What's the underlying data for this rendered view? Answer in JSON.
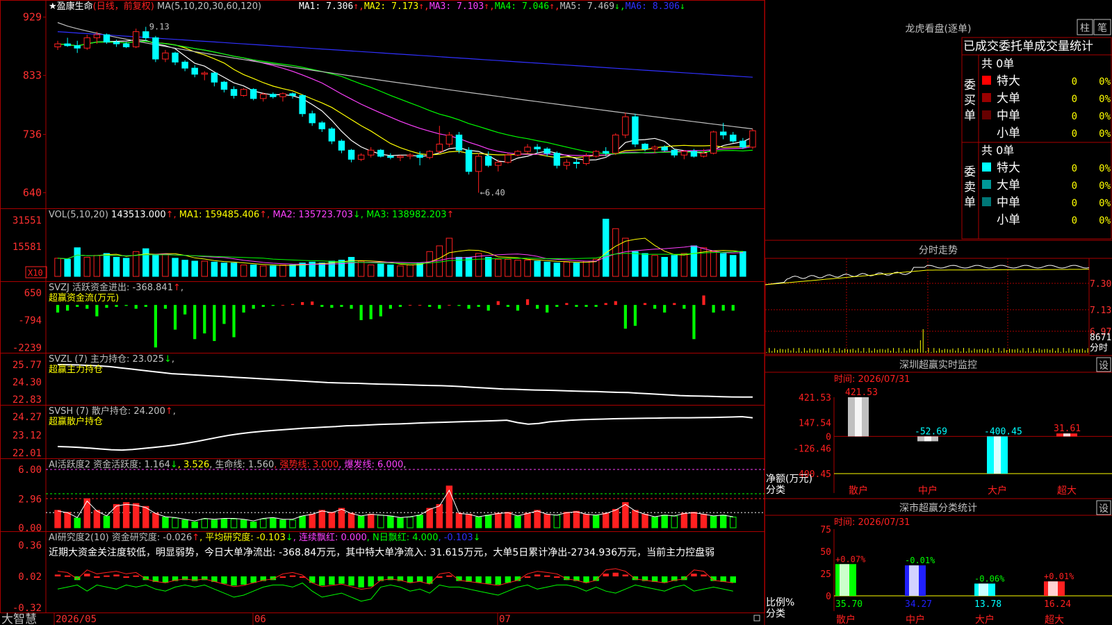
{
  "colors": {
    "up": "#ff2020",
    "down": "#00ffff",
    "bg": "#000000",
    "grid": "#aa0000",
    "axisText": "#ff3030",
    "white": "#ffffff",
    "yellow": "#ffff00",
    "magenta": "#ff40ff",
    "green": "#00ff00",
    "blue": "#3030ff",
    "gray": "#c0c0c0",
    "cyanbar": "#00ffff"
  },
  "main": {
    "title": "★盈康生命",
    "period": "(日线，前复权)",
    "ma_prefix": "MA(5,10,20,30,60,120)",
    "ma_legend": [
      {
        "label": "MA1:",
        "value": "7.306",
        "arrow": "↑",
        "color": "#ffffff"
      },
      {
        "label": "MA2:",
        "value": "7.173",
        "arrow": "↑",
        "color": "#ffff00"
      },
      {
        "label": "MA3:",
        "value": "7.103",
        "arrow": "↑",
        "color": "#ff40ff"
      },
      {
        "label": "MA4:",
        "value": "7.046",
        "arrow": "↑",
        "color": "#00ff00"
      },
      {
        "label": "MA5:",
        "value": "7.469",
        "arrow": "↓",
        "color": "#c0c0c0"
      },
      {
        "label": "MA6:",
        "value": "8.306",
        "arrow": "↓",
        "color": "#3030ff"
      }
    ],
    "yticks": [
      "929",
      "833",
      "736",
      "640"
    ],
    "high_label": "9.13",
    "low_label": "←6.40"
  },
  "vol": {
    "legend_prefix": "VOL(5,10,20)",
    "value": "143513.000",
    "ma1": "MA1: 159485.406",
    "ma2": "MA2: 135723.703",
    "ma3": "MA3: 138982.203",
    "ma1_arrow": "↑",
    "ma2_arrow": "↓",
    "ma3_arrow": "↑",
    "yticks": [
      "31551",
      "15581"
    ],
    "unit": "X10"
  },
  "svzj": {
    "label": "SVZJ  活跃资金进出: -368.841",
    "arrow": "↑",
    "arrow2": ",",
    "sub": "超赢资金流(万元)",
    "yticks": [
      "650",
      "-794",
      "-2239"
    ]
  },
  "svzl": {
    "label": "SVZL (7) 主力持仓: 23.025",
    "arrow": "↓",
    "arrow2": ",",
    "sub": "超赢主力持仓",
    "yticks": [
      "25.77",
      "24.30",
      "22.83"
    ]
  },
  "svsh": {
    "label": "SVSH (7) 散户持仓: 24.200",
    "arrow": "↑",
    "arrow2": ",",
    "sub": "超赢散户持仓",
    "yticks": [
      "24.27",
      "23.12",
      "22.01"
    ]
  },
  "ai1": {
    "label": "AI活跃度2 资金活跃度: 1.164",
    "a1": "↓",
    "v2": ", 3.526",
    "v3": ", 生命线: 1.560",
    "v4": ", 强势线: 3.000",
    "v5": ", 爆发线: 6.000",
    "v6": ",",
    "yticks": [
      "6.00",
      "2.96",
      "0.00"
    ]
  },
  "ai2": {
    "label": "AI研究度2(10) 资金研究度: -0.026",
    "a1": "↑",
    "v2": ", 平均研究度: -0.103",
    "a2": "↓",
    "v3": ", 连续飘红: 0.000",
    "v4": ", N日飘红: 4.000",
    "v5": ", -0.103",
    "a5": "↓",
    "note": "近期大资金关注度较低，明显弱势，今日大单净流出: -368.84万元，其中特大单净流入: 31.615万元，大单5日累计净出-2734.936万元，当前主力控盘弱",
    "yticks": [
      "0.36",
      "0.02",
      "-0.32"
    ]
  },
  "footer": {
    "brand": "大智慧",
    "dates": [
      "2026/05",
      "06",
      "07"
    ]
  },
  "lhb": {
    "title": "龙虎看盘(逐单)",
    "btn1": "柱",
    "btn2": "笔",
    "subtitle": "已成交委托单成交量统计",
    "buy_side": "委买单",
    "sell_side": "委卖单",
    "buy_total": "共 0单",
    "sell_total": "共 0单",
    "buy_rows": [
      {
        "name": "特大",
        "val": "0",
        "pct": "0%",
        "color": "#ff0000"
      },
      {
        "name": "大单",
        "val": "0",
        "pct": "0%",
        "color": "#990000"
      },
      {
        "name": "中单",
        "val": "0",
        "pct": "0%",
        "color": "#660000"
      },
      {
        "name": "小单",
        "val": "0",
        "pct": "0%",
        "color": "#000000"
      }
    ],
    "sell_rows": [
      {
        "name": "特大",
        "val": "0",
        "pct": "0%",
        "color": "#00ffff"
      },
      {
        "name": "大单",
        "val": "0",
        "pct": "0%",
        "color": "#009999"
      },
      {
        "name": "中单",
        "val": "0",
        "pct": "0%",
        "color": "#007777"
      },
      {
        "name": "小单",
        "val": "0",
        "pct": "0%",
        "color": "#000000"
      }
    ]
  },
  "intraday": {
    "title": "分时走势",
    "yticks": [
      "7.30",
      "7.13",
      "6.97"
    ],
    "vol_tick": "8671",
    "vol_label": "分时"
  },
  "monitor": {
    "title": "深圳超赢实时监控",
    "btn": "设",
    "time": "时间: 2026/07/31",
    "yticks": [
      "421.53",
      "147.54",
      "0",
      "-126.46",
      "-400.45"
    ],
    "ylabel": "净额(万元)",
    "xlabel": "分类",
    "cats": [
      {
        "name": "散户",
        "value": 421.53,
        "label": "421.53"
      },
      {
        "name": "中户",
        "value": -52.69,
        "label": "-52.69"
      },
      {
        "name": "大户",
        "value": -400.45,
        "label": "-400.45"
      },
      {
        "name": "超大",
        "value": 31.61,
        "label": "31.61"
      }
    ]
  },
  "classstat": {
    "title": "深市超赢分类统计",
    "btn": "设",
    "time": "时间: 2026/07/31",
    "yticks": [
      "75",
      "50",
      "25",
      "0"
    ],
    "ylabel": "比例%",
    "xlabel": "分类",
    "cats": [
      {
        "name": "散户",
        "value": 35.7,
        "label": "35.70",
        "delta": "+0.07%",
        "color": "#00ff00"
      },
      {
        "name": "中户",
        "value": 34.27,
        "label": "34.27",
        "delta": "-0.01%",
        "color": "#2020ff"
      },
      {
        "name": "大户",
        "value": 13.78,
        "label": "13.78",
        "delta": "-0.06%",
        "color": "#00ffff"
      },
      {
        "name": "超大",
        "value": 16.24,
        "label": "16.24",
        "delta": "+0.01%",
        "color": "#ff2020"
      }
    ]
  },
  "chart_data": [
    {
      "type": "candlestick",
      "title": "盈康生命 (日线，前复权)",
      "ylim": [
        6.2,
        9.4
      ],
      "ohlc": [
        [
          8.8,
          8.9,
          8.75,
          8.85
        ],
        [
          8.85,
          8.95,
          8.8,
          8.82
        ],
        [
          8.82,
          8.9,
          8.7,
          8.78
        ],
        [
          8.78,
          9.0,
          8.75,
          8.95
        ],
        [
          8.95,
          9.05,
          8.85,
          9.0
        ],
        [
          9.0,
          9.02,
          8.85,
          8.88
        ],
        [
          8.88,
          8.92,
          8.8,
          8.85
        ],
        [
          8.85,
          8.88,
          8.78,
          8.8
        ],
        [
          8.8,
          9.1,
          8.78,
          9.05
        ],
        [
          9.05,
          9.13,
          8.9,
          8.95
        ],
        [
          8.95,
          8.98,
          8.55,
          8.6
        ],
        [
          8.6,
          8.75,
          8.55,
          8.7
        ],
        [
          8.7,
          8.72,
          8.5,
          8.55
        ],
        [
          8.55,
          8.58,
          8.4,
          8.45
        ],
        [
          8.45,
          8.5,
          8.3,
          8.35
        ],
        [
          8.35,
          8.4,
          8.25,
          8.37
        ],
        [
          8.37,
          8.38,
          8.15,
          8.22
        ],
        [
          8.22,
          8.24,
          8.05,
          8.1
        ],
        [
          8.1,
          8.15,
          7.95,
          8.0
        ],
        [
          8.0,
          8.12,
          7.98,
          8.1
        ],
        [
          8.1,
          8.12,
          7.92,
          7.95
        ],
        [
          7.95,
          8.05,
          7.9,
          8.02
        ],
        [
          8.02,
          8.05,
          7.95,
          7.98
        ],
        [
          7.98,
          8.05,
          7.9,
          8.03
        ],
        [
          8.03,
          8.05,
          7.95,
          8.0
        ],
        [
          8.0,
          8.02,
          7.65,
          7.7
        ],
        [
          7.7,
          7.75,
          7.5,
          7.55
        ],
        [
          7.55,
          7.58,
          7.4,
          7.45
        ],
        [
          7.45,
          7.48,
          7.2,
          7.25
        ],
        [
          7.25,
          7.28,
          7.05,
          7.1
        ],
        [
          7.1,
          7.12,
          6.9,
          6.95
        ],
        [
          6.95,
          7.05,
          6.92,
          7.02
        ],
        [
          7.02,
          7.15,
          6.98,
          7.1
        ],
        [
          7.1,
          7.12,
          6.98,
          7.0
        ],
        [
          7.0,
          7.05,
          6.95,
          6.98
        ],
        [
          6.98,
          7.02,
          6.92,
          7.0
        ],
        [
          7.0,
          7.05,
          6.95,
          7.02
        ],
        [
          7.02,
          7.08,
          6.85,
          6.98
        ],
        [
          6.98,
          7.1,
          6.95,
          7.08
        ],
        [
          7.08,
          7.5,
          7.05,
          7.2
        ],
        [
          7.2,
          7.4,
          7.15,
          7.35
        ],
        [
          7.35,
          7.4,
          7.05,
          7.1
        ],
        [
          7.1,
          7.15,
          6.7,
          6.75
        ],
        [
          6.75,
          7.05,
          6.4,
          7.0
        ],
        [
          7.0,
          7.08,
          6.82,
          6.85
        ],
        [
          6.85,
          6.95,
          6.75,
          6.9
        ],
        [
          6.9,
          7.05,
          6.88,
          7.02
        ],
        [
          7.02,
          7.1,
          7.0,
          7.08
        ],
        [
          7.08,
          7.2,
          7.05,
          7.15
        ],
        [
          7.15,
          7.2,
          7.05,
          7.12
        ],
        [
          7.12,
          7.15,
          7.0,
          7.05
        ],
        [
          7.05,
          7.08,
          6.8,
          6.85
        ],
        [
          6.85,
          6.95,
          6.78,
          6.9
        ],
        [
          6.9,
          6.95,
          6.8,
          6.88
        ],
        [
          6.88,
          7.05,
          6.85,
          7.0
        ],
        [
          7.0,
          7.1,
          6.98,
          7.08
        ],
        [
          7.08,
          7.15,
          7.0,
          7.05
        ],
        [
          7.05,
          7.38,
          7.02,
          7.35
        ],
        [
          7.35,
          7.72,
          7.3,
          7.65
        ],
        [
          7.65,
          7.7,
          7.15,
          7.2
        ],
        [
          7.2,
          7.22,
          7.08,
          7.12
        ],
        [
          7.12,
          7.18,
          7.05,
          7.15
        ],
        [
          7.15,
          7.18,
          7.08,
          7.1
        ],
        [
          7.1,
          7.12,
          6.98,
          7.02
        ],
        [
          7.02,
          7.1,
          6.95,
          7.08
        ],
        [
          7.08,
          7.12,
          6.98,
          7.0
        ],
        [
          7.0,
          7.12,
          6.98,
          7.05
        ],
        [
          7.05,
          7.42,
          7.03,
          7.4
        ],
        [
          7.4,
          7.55,
          7.28,
          7.35
        ],
        [
          7.35,
          7.4,
          7.22,
          7.25
        ],
        [
          7.25,
          7.3,
          7.12,
          7.15
        ],
        [
          7.15,
          7.45,
          7.12,
          7.42
        ]
      ]
    },
    {
      "type": "bar",
      "title": "VOL(5,10,20)",
      "values": [
        95,
        90,
        150,
        100,
        110,
        120,
        100,
        95,
        130,
        145,
        110,
        115,
        95,
        85,
        80,
        80,
        75,
        70,
        70,
        60,
        60,
        55,
        55,
        60,
        60,
        70,
        75,
        70,
        80,
        85,
        100,
        80,
        60,
        65,
        60,
        55,
        60,
        70,
        130,
        160,
        200,
        100,
        100,
        120,
        100,
        90,
        90,
        85,
        85,
        80,
        75,
        70,
        75,
        70,
        80,
        90,
        300,
        250,
        200,
        130,
        120,
        110,
        100,
        110,
        120,
        160,
        150,
        130,
        120,
        110,
        130
      ]
    },
    {
      "type": "bar",
      "title": "SVZJ 活跃资金进出",
      "values": [
        -400,
        -300,
        -100,
        -200,
        -600,
        -150,
        -100,
        -50,
        -200,
        -100,
        -2239,
        -200,
        -1300,
        -500,
        -1800,
        -1500,
        -1900,
        -1000,
        -1700,
        -400,
        -200,
        -100,
        -50,
        0,
        50,
        150,
        180,
        -100,
        -150,
        -100,
        -200,
        -800,
        -750,
        -600,
        -200,
        -100,
        0,
        0,
        -100,
        -200,
        0,
        -50,
        -200,
        -100,
        -300,
        200,
        -100,
        -300,
        300,
        -200,
        -400,
        -100,
        100,
        -100,
        -100,
        -100,
        100,
        200,
        -1250,
        -1100,
        100,
        -200,
        -400,
        100,
        -200,
        -1800,
        500,
        -400,
        -300,
        -300
      ]
    },
    {
      "type": "line",
      "title": "SVZL 主力持仓",
      "ylim": [
        22.83,
        25.77
      ],
      "values": [
        25.77,
        25.76,
        25.74,
        25.7,
        25.66,
        25.6,
        25.5,
        25.4,
        25.3,
        25.2,
        25.1,
        25.0,
        24.95,
        24.9,
        24.85,
        24.8,
        24.75,
        24.7,
        24.65,
        24.6,
        24.55,
        24.5,
        24.45,
        24.4,
        24.35,
        24.3,
        24.25,
        24.22,
        24.2,
        24.18,
        24.15,
        24.12,
        24.1,
        24.08,
        24.05,
        24.02,
        24.0,
        23.98,
        23.95,
        23.9,
        23.85,
        23.8,
        23.75,
        23.7,
        23.68,
        23.65,
        23.62,
        23.6,
        23.58,
        23.55,
        23.52,
        23.5,
        23.48,
        23.45,
        23.42,
        23.4,
        23.35,
        23.3,
        23.25,
        23.2,
        23.15,
        23.12,
        23.1,
        23.08,
        23.05,
        23.03,
        23.02,
        23.025
      ]
    },
    {
      "type": "line",
      "title": "SVSH 散户持仓",
      "ylim": [
        22.01,
        24.27
      ],
      "values": [
        22.4,
        22.38,
        22.35,
        22.3,
        22.25,
        22.2,
        22.18,
        22.22,
        22.28,
        22.35,
        22.42,
        22.5,
        22.6,
        22.72,
        22.85,
        22.98,
        23.1,
        23.2,
        23.28,
        23.35,
        23.4,
        23.45,
        23.5,
        23.55,
        23.58,
        23.62,
        23.65,
        23.7,
        23.72,
        23.75,
        23.78,
        23.8,
        23.82,
        23.85,
        23.88,
        23.9,
        23.92,
        23.94,
        23.96,
        23.98,
        24.0,
        24.02,
        24.05,
        23.9,
        23.8,
        23.85,
        23.95,
        24.0,
        24.05,
        24.08,
        24.1,
        24.12,
        24.14,
        24.15,
        24.16,
        24.17,
        24.18,
        24.19,
        24.2,
        24.2,
        24.21,
        24.22,
        24.23,
        24.25,
        24.27,
        24.2
      ]
    },
    {
      "type": "bar",
      "title": "AI活跃度2",
      "ylim": [
        0,
        6
      ],
      "values": [
        1.8,
        1.6,
        1.0,
        3.0,
        1.8,
        1.2,
        2.4,
        2.6,
        2.5,
        2.2,
        1.5,
        1.1,
        1.0,
        0.8,
        0.6,
        0.9,
        0.8,
        0.9,
        0.9,
        0.8,
        0.6,
        0.9,
        1.0,
        0.8,
        0.8,
        1.2,
        1.4,
        1.8,
        1.6,
        2.0,
        1.5,
        1.2,
        1.4,
        1.3,
        1.2,
        1.0,
        1.1,
        1.3,
        2.0,
        2.4,
        4.3,
        1.5,
        1.4,
        1.1,
        1.3,
        1.5,
        1.6,
        1.2,
        1.5,
        1.8,
        1.4,
        1.3,
        1.6,
        1.7,
        1.4,
        1.3,
        1.5,
        1.9,
        2.6,
        1.8,
        1.4,
        1.1,
        1.3,
        1.2,
        1.5,
        1.6,
        1.4,
        1.2,
        1.3,
        1.1
      ]
    },
    {
      "type": "bar",
      "title": "AI研究度2(10)",
      "ylim": [
        -0.32,
        0.36
      ],
      "values": [
        0.04,
        0.03,
        -0.02,
        0.05,
        0.02,
        0.03,
        0.04,
        0.02,
        0.03,
        -0.02,
        -0.04,
        -0.05,
        -0.03,
        -0.02,
        -0.03,
        -0.02,
        -0.04,
        -0.06,
        -0.08,
        -0.07,
        -0.05,
        -0.03,
        -0.02,
        0.02,
        0.03,
        0.01,
        -0.05,
        -0.08,
        -0.07,
        -0.06,
        -0.08,
        -0.1,
        -0.09,
        -0.03,
        -0.02,
        -0.03,
        -0.05,
        -0.04,
        -0.06,
        0.02,
        0.03,
        -0.03,
        -0.04,
        -0.05,
        -0.06,
        -0.07,
        -0.05,
        -0.03,
        0.02,
        0.04,
        0.03,
        0.02,
        -0.02,
        -0.03,
        -0.05,
        -0.03,
        0.05,
        0.06,
        0.04,
        -0.02,
        -0.03,
        -0.04,
        -0.05,
        -0.03,
        -0.02,
        0.05,
        0.04,
        -0.03,
        -0.04,
        -0.05
      ]
    }
  ]
}
